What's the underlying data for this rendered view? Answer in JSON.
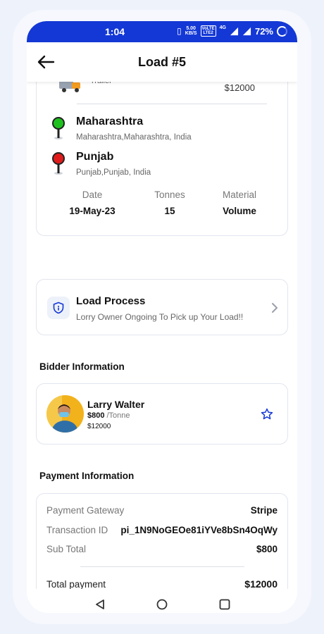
{
  "status_bar": {
    "time": "1:04",
    "speed_value": "5.00",
    "speed_unit": "KB/S",
    "network_top": "VoLTE",
    "network_bottom": "LTE2",
    "net_type": "4G",
    "battery": "72%"
  },
  "header": {
    "title": "Load #5",
    "back_icon": "arrow-left-icon"
  },
  "route": {
    "truck_icon": "truck-icon",
    "truck_type": "Trailer",
    "price": "$12000",
    "origin": {
      "title": "Maharashtra",
      "address": "Maharashtra,Maharashtra, India",
      "pin_color": "#1fc11f"
    },
    "destination": {
      "title": "Punjab",
      "address": "Punjab,Punjab, India",
      "pin_color": "#e01b1b"
    },
    "stats": [
      {
        "label": "Date",
        "value": "19-May-23"
      },
      {
        "label": "Tonnes",
        "value": "15"
      },
      {
        "label": "Material",
        "value": "Volume"
      }
    ]
  },
  "load_process": {
    "icon": "shield-icon",
    "title": "Load Process",
    "subtitle": "Lorry Owner Ongoing To Pick up Your Load!!"
  },
  "bidder": {
    "section_title": "Bidder Information",
    "name": "Larry Walter",
    "rate": "$800",
    "rate_unit": "/Tonne",
    "price": "$12000"
  },
  "payment": {
    "section_title": "Payment Information",
    "rows": [
      {
        "label": "Payment Gateway",
        "value": "Stripe"
      },
      {
        "label": "Transaction ID",
        "value": "pi_1N9NoGEOe81iYVe8bSn4OqWy"
      },
      {
        "label": "Sub Total",
        "value": "$800"
      }
    ],
    "total_label": "Total payment",
    "total_value": "$12000"
  },
  "colors": {
    "accent": "#1438d6",
    "star": "#1438d6"
  }
}
